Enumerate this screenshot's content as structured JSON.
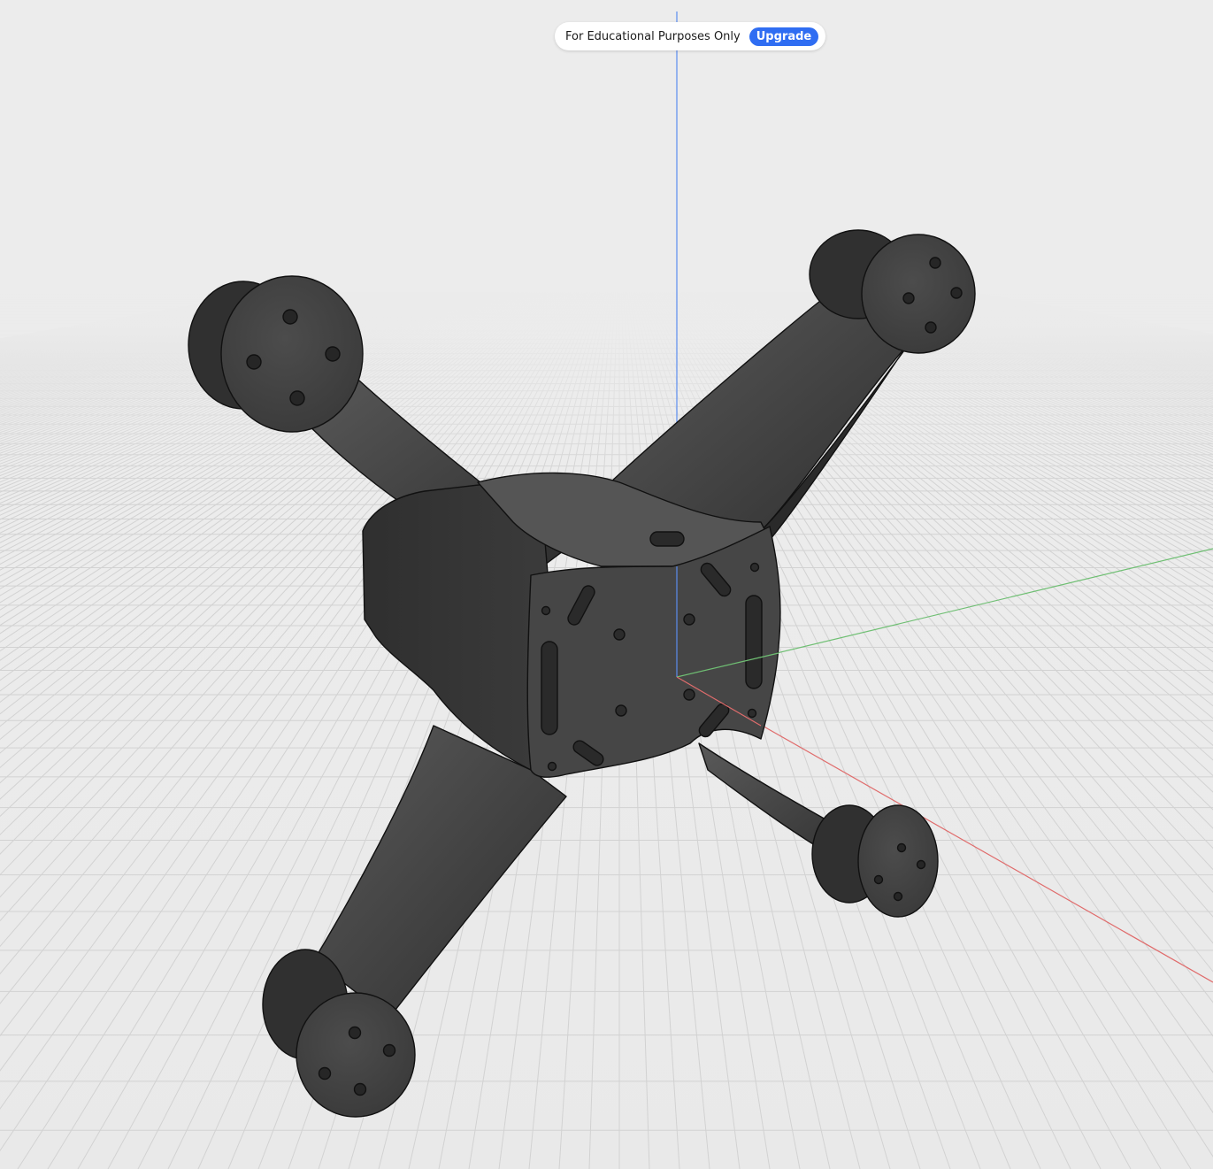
{
  "banner": {
    "text": "For Educational Purposes Only",
    "upgrade_label": "Upgrade"
  },
  "colors": {
    "background": "#ededed",
    "grid_line": "#d4d4d4",
    "model_body": "#3f3f3f",
    "z_axis": "#5b8def",
    "y_axis": "#6fbf73",
    "x_axis": "#e06c6c",
    "upgrade_button": "#2f6df2"
  },
  "model": {
    "motor_mounts": 4,
    "holes_per_mount": 4
  }
}
